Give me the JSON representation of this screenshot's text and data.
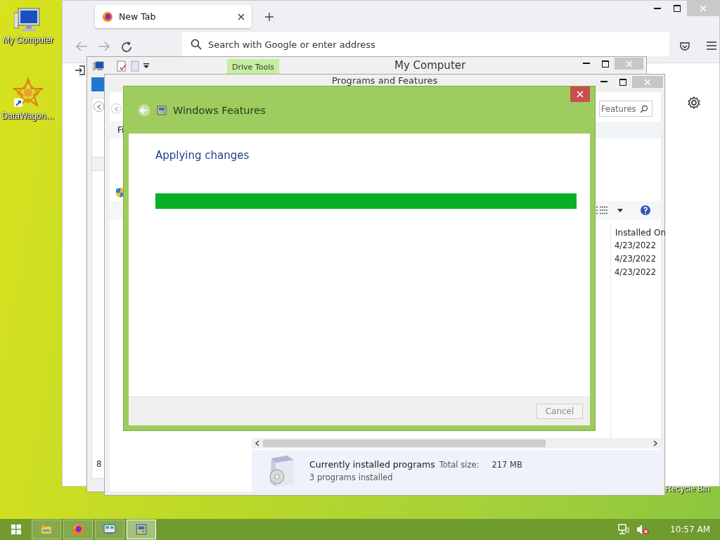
{
  "desktop": {
    "icons": [
      {
        "kind": "computer",
        "label": "My Computer"
      },
      {
        "kind": "star",
        "label": "DataWagon…"
      }
    ],
    "recycle_bin_label": "Recycle Bin"
  },
  "browser": {
    "tabs": [
      {
        "label": "New Tab",
        "selected": true
      }
    ],
    "address": {
      "placeholder": "Search with Google or enter address"
    }
  },
  "explorer": {
    "title": "My Computer",
    "ribbon_tab": "Drive Tools",
    "status_digit": "8"
  },
  "programs": {
    "title": "Programs and Features",
    "search": {
      "placeholder": "Features"
    },
    "menu_label": "Fi",
    "column": "Installed On",
    "rows": [
      "4/23/2022",
      "4/23/2022",
      "4/23/2022"
    ],
    "details": {
      "title": "Currently installed programs",
      "size_label": "Total size:",
      "size": "217 MB",
      "count": "3 programs installed"
    }
  },
  "dialog": {
    "title": "Windows Features",
    "status": "Applying changes",
    "progress": {
      "level": 1
    },
    "cancel": {
      "label": "Cancel",
      "disabled": true
    }
  },
  "taskbar": {
    "apps": [
      {
        "kind": "folder",
        "selected": false
      },
      {
        "kind": "firefox",
        "selected": false
      },
      {
        "kind": "control-panel",
        "selected": false
      },
      {
        "kind": "features",
        "selected": true
      }
    ],
    "clock": "10:57 AM"
  }
}
